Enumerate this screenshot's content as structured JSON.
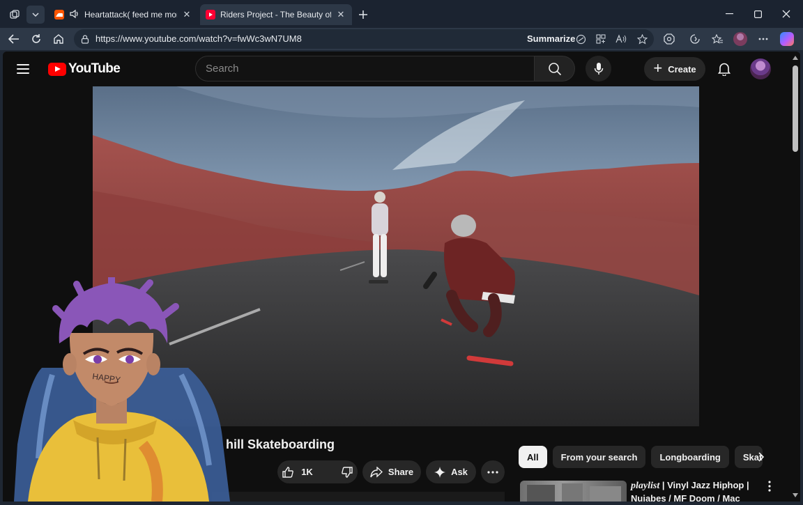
{
  "tabs": [
    {
      "title": "Heartattack( feed me money",
      "active": false
    },
    {
      "title": "Riders Project - The Beauty of Do",
      "active": true
    }
  ],
  "toolbar": {
    "url": "https://www.youtube.com/watch?v=fwWc3wN7UM8",
    "summarize_label": "Summarize"
  },
  "youtube": {
    "logo_text": "YouTube",
    "search_placeholder": "Search",
    "create_label": "Create"
  },
  "video": {
    "title_visible": "hill Skateboarding",
    "like_count": "1K",
    "share_label": "Share",
    "ask_label": "Ask"
  },
  "chips": [
    "All",
    "From your search",
    "Longboarding",
    "Skat"
  ],
  "recommendation": {
    "title_italic": "playlist",
    "title_rest": " | Vinyl Jazz Hiphop | Nujabes / MF Doom / Mac"
  },
  "overlay": {
    "tattoo_text": "HAPPY"
  }
}
